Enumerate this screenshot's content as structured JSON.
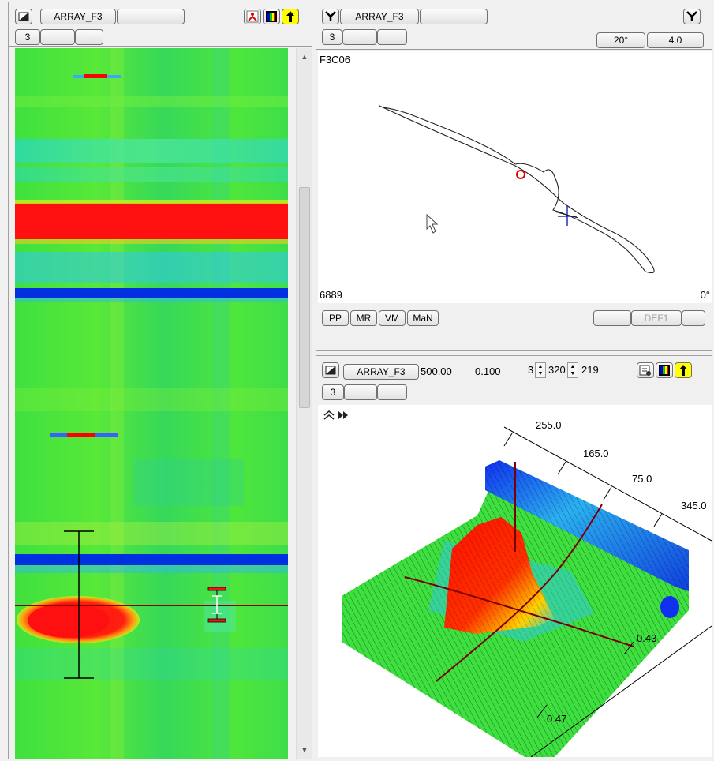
{
  "left_panel": {
    "title_button": "ARRAY_F3",
    "blank_button": "",
    "row2": [
      "3",
      "",
      ""
    ],
    "icons": [
      "channel-select-icon",
      "palette-icon",
      "up-arrow-icon"
    ]
  },
  "polar_panel": {
    "title_button": "ARRAY_F3",
    "blank_button": "",
    "row2": [
      "3",
      "",
      ""
    ],
    "angle_button": "20°",
    "scale_button": "4.0",
    "trace_label": "F3C06",
    "bottom_left_value": "6889",
    "bottom_right_value": "0°",
    "mode_buttons": [
      "PP",
      "MR",
      "VM",
      "MaN"
    ],
    "def_button": "DEF1",
    "icons": [
      "y-filter-icon",
      "y-filter-right-icon",
      "cursor-icon"
    ]
  },
  "surface_panel": {
    "title_button": "ARRAY_F3",
    "readout_a": "500.00",
    "readout_b": "0.100",
    "spin1_value": "3",
    "spin2_value": "320",
    "spin3_value": "219",
    "row2": [
      "3",
      "",
      ""
    ],
    "axis_labels_top": [
      "255.0",
      "165.0",
      "75.0",
      "345.0"
    ],
    "axis_labels_side": [
      "0.43",
      "0.47"
    ],
    "icons": [
      "collapse-icon",
      "play-icon",
      "settings-icon",
      "palette-icon",
      "up-arrow-icon"
    ]
  },
  "colors": {
    "accent_red": "#ff0000",
    "accent_blue": "#0022e0",
    "field_green": "#3fe03f",
    "highlight_yellow": "#ffff00"
  }
}
